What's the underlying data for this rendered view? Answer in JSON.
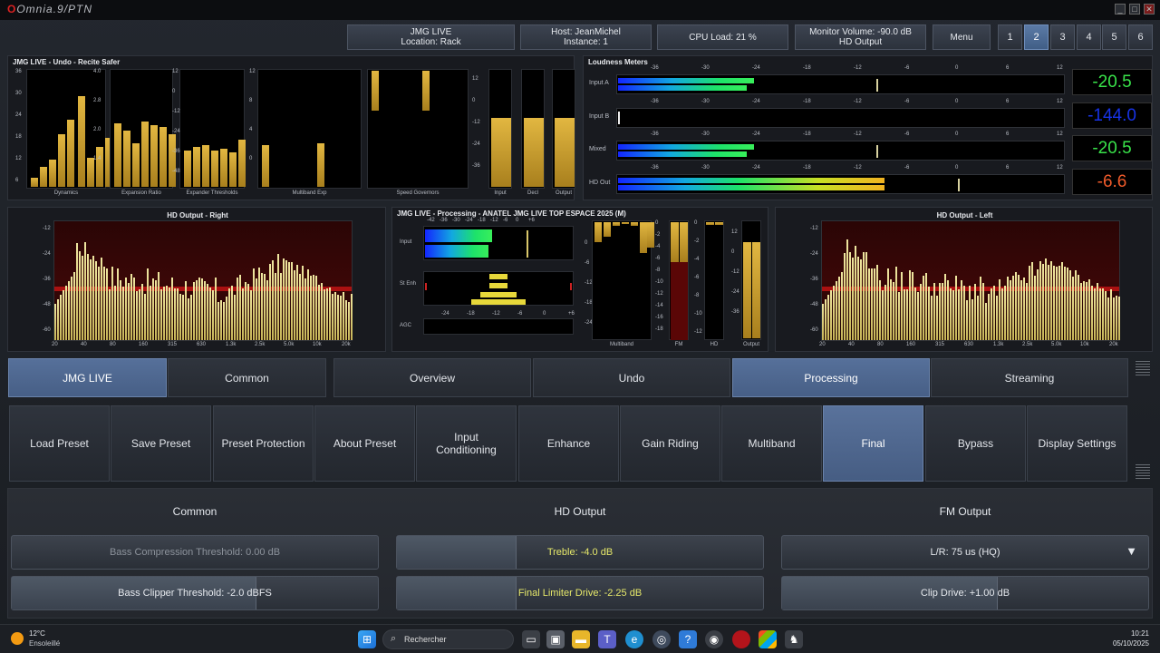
{
  "window": {
    "title_logo": "Omnia.9/PTN",
    "min": "_",
    "max": "□",
    "close": "✕"
  },
  "header": {
    "station_line1": "JMG LIVE",
    "station_line2": "Location: Rack",
    "host_line1": "Host: JeanMichel",
    "host_line2": "Instance: 1",
    "cpu": "CPU Load: 21 %",
    "monitor_line1": "Monitor Volume: -90.0 dB",
    "monitor_line2": "HD Output",
    "menu": "Menu",
    "presets": [
      "1",
      "2",
      "3",
      "4",
      "5",
      "6"
    ],
    "active_preset": "2"
  },
  "undo_panel": {
    "title": "JMG LIVE - Undo - Recite Safer",
    "group_labels": [
      "Dynamics",
      "Expansion Ratio",
      "Expander Thresholds",
      "Multiband Exp",
      "Speed Governors",
      "Input",
      "Decl",
      "Output"
    ],
    "scale_dyn": [
      "36",
      "30",
      "24",
      "18",
      "12",
      "6"
    ],
    "scale_ratio": [
      "4.0",
      "2.8",
      "2.0",
      "1.4"
    ],
    "scale_thresh": [
      "12",
      "0",
      "-12",
      "-24",
      "-36",
      "-48"
    ],
    "scale_mbexp": [
      "12",
      "8",
      "4",
      "0"
    ],
    "scale_io": [
      "12",
      "0",
      "-12",
      "-24",
      "-36"
    ]
  },
  "loudness": {
    "title": "Loudness Meters",
    "scale": [
      "-36",
      "-30",
      "-24",
      "-18",
      "-12",
      "-6",
      "0",
      "6",
      "12"
    ],
    "rows": [
      {
        "label": "Input A",
        "value": "-20.5",
        "color": "#39e34a"
      },
      {
        "label": "Input B",
        "value": "-144.0",
        "color": "#1733e6"
      },
      {
        "label": "Mixed",
        "value": "-20.5",
        "color": "#39e34a"
      },
      {
        "label": "HD Out",
        "value": "-6.6",
        "color": "#ef5a2a"
      }
    ]
  },
  "spectrum_right": {
    "title": "HD Output - Right",
    "y": [
      "-12",
      "-24",
      "-36",
      "-48",
      "-60"
    ],
    "x": [
      "20",
      "40",
      "80",
      "160",
      "315",
      "630",
      "1.3k",
      "2.5k",
      "5.0k",
      "10k",
      "20k"
    ]
  },
  "spectrum_left": {
    "title": "HD Output - Left",
    "y": [
      "-12",
      "-24",
      "-36",
      "-48",
      "-60"
    ],
    "x": [
      "20",
      "40",
      "80",
      "160",
      "315",
      "630",
      "1.3k",
      "2.5k",
      "5.0k",
      "10k",
      "20k"
    ]
  },
  "processing": {
    "title": "JMG LIVE - Processing - ANATEL JMG LIVE TOP ESPACE 2025 (M)",
    "top_scale": [
      "-42",
      "-36",
      "-30",
      "-24",
      "-18",
      "-12",
      "-6",
      "0",
      "+6"
    ],
    "bottom_scale": [
      "-24",
      "-18",
      "-12",
      "-6",
      "0",
      "+6"
    ],
    "row_labels": [
      "Input",
      "St Enh",
      "AGC"
    ],
    "mb_scale": [
      "0",
      "-6",
      "-12",
      "-18",
      "-24"
    ],
    "fm_scale": [
      "0",
      "-2",
      "-4",
      "-6",
      "-8",
      "-10",
      "-12",
      "-14",
      "-16",
      "-18"
    ],
    "hd_scale": [
      "0",
      "-2",
      "-4",
      "-6",
      "-8",
      "-10",
      "-12"
    ],
    "out_scale": [
      "12",
      "0",
      "-12",
      "-24",
      "-36"
    ],
    "labels": [
      "Multiband",
      "FM",
      "HD",
      "Output"
    ]
  },
  "nav1": {
    "left": [
      "JMG LIVE",
      "Common"
    ],
    "right": [
      "Overview",
      "Undo",
      "Processing",
      "Streaming"
    ],
    "active": "Processing"
  },
  "nav2": {
    "items": [
      "Load Preset",
      "Save Preset",
      "Preset Protection",
      "About Preset",
      "Input Conditioning",
      "Enhance",
      "Gain Riding",
      "Multiband",
      "Final",
      "Bypass",
      "Display Settings"
    ],
    "active": "Final"
  },
  "controls": {
    "headers": [
      "Common",
      "HD Output",
      "FM Output"
    ],
    "bass_comp": "Bass Compression Threshold: 0.00 dB",
    "bass_clip": "Bass Clipper Threshold: -2.0 dBFS",
    "treble": "Treble: -4.0 dB",
    "final_limiter": "Final Limiter Drive: -2.25 dB",
    "lr": "L/R: 75 us (HQ)",
    "clip_drive": "Clip Drive: +1.00 dB"
  },
  "taskbar": {
    "temp": "12°C",
    "weather": "Ensoleillé",
    "search": "Rechercher",
    "time": "10:21",
    "date": "05/10/2025"
  }
}
